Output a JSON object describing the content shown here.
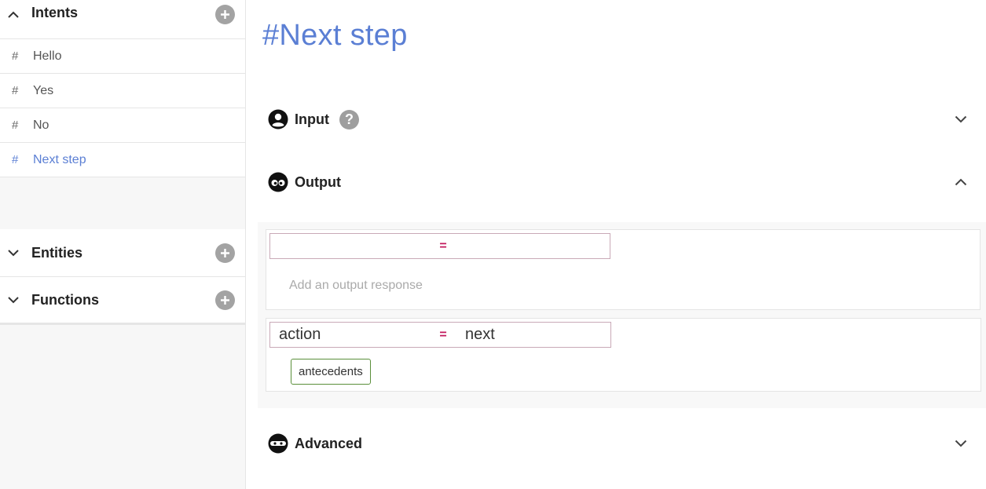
{
  "sidebar": {
    "intents": {
      "title": "Intents",
      "items": [
        {
          "hash": "#",
          "label": "Hello"
        },
        {
          "hash": "#",
          "label": "Yes"
        },
        {
          "hash": "#",
          "label": "No"
        },
        {
          "hash": "#",
          "label": "Next step"
        }
      ]
    },
    "entities": {
      "title": "Entities"
    },
    "functions": {
      "title": "Functions"
    }
  },
  "main": {
    "title": "#Next step",
    "sections": {
      "input": {
        "label": "Input",
        "help": "?"
      },
      "output": {
        "label": "Output"
      },
      "advanced": {
        "label": "Advanced"
      }
    },
    "responses": [
      {
        "condition_lhs": "",
        "operator": "=",
        "condition_rhs": "",
        "placeholder": "Add an output response"
      },
      {
        "condition_lhs": "action",
        "operator": "=",
        "condition_rhs": "next",
        "tag": "antecedents"
      }
    ]
  },
  "colors": {
    "accent": "#5b7fd4",
    "operator": "#c2185b",
    "tag_border": "#5a8f3a",
    "add_button": "#a3a3a3"
  },
  "icons": [
    "chevron-up-icon",
    "chevron-down-icon",
    "plus-icon",
    "user-circle-icon",
    "help-icon",
    "eyes-icon",
    "ninja-icon"
  ]
}
